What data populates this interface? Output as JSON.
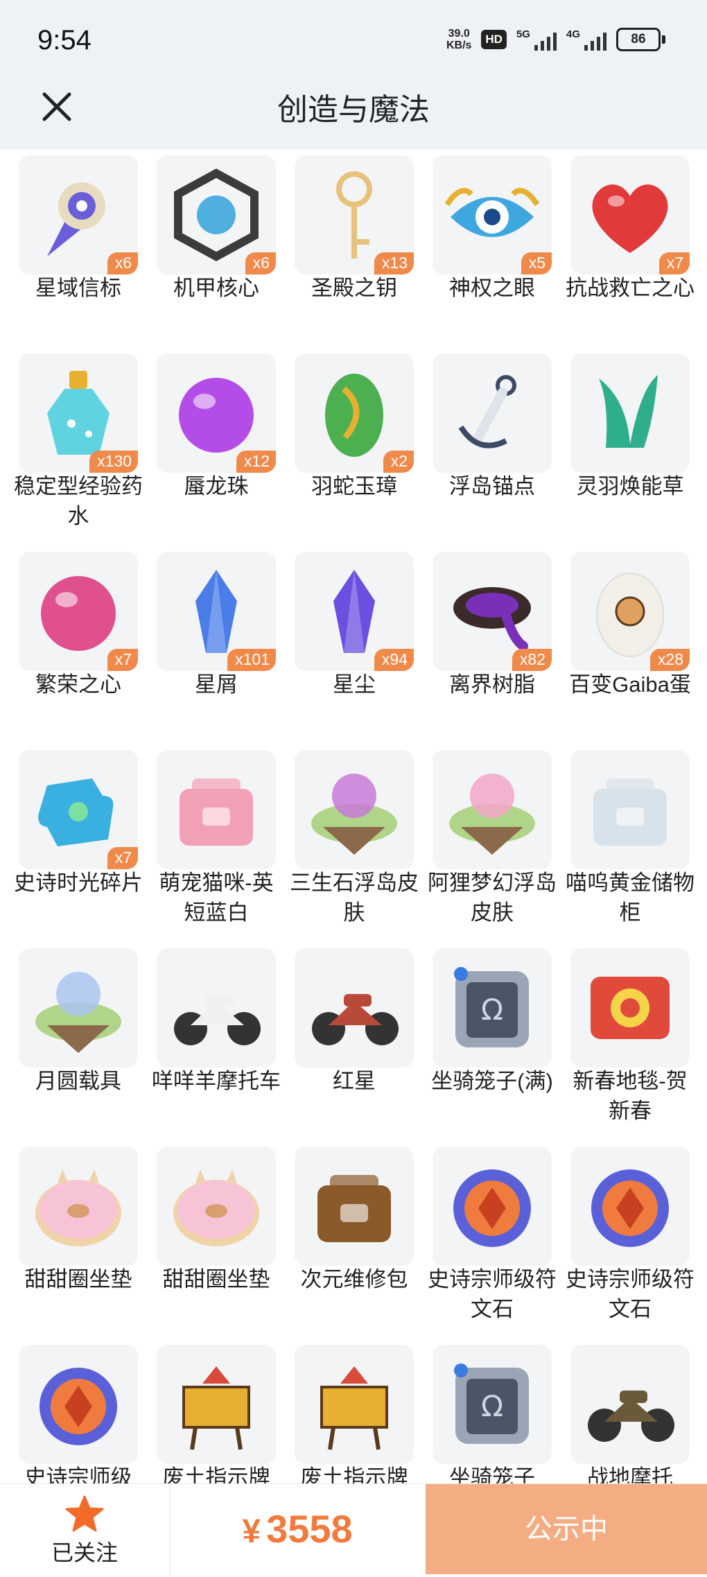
{
  "status_bar": {
    "time": "9:54",
    "net_speed_value": "39.0",
    "net_speed_unit": "KB/s",
    "hd_badge": "HD",
    "signal_1_label": "5G",
    "signal_2_label": "4G",
    "battery": "86"
  },
  "header": {
    "title": "创造与魔法",
    "close_icon": "close-icon"
  },
  "items": [
    {
      "name": "星域信标",
      "qty": "x6",
      "icon": "star-beacon-icon",
      "color": "#6a5fd8"
    },
    {
      "name": "机甲核心",
      "qty": "x6",
      "icon": "mecha-core-icon",
      "color": "#3b3b3b"
    },
    {
      "name": "圣殿之钥",
      "qty": "x13",
      "icon": "temple-key-icon",
      "color": "#e8c27a"
    },
    {
      "name": "神权之眼",
      "qty": "x5",
      "icon": "divine-eye-icon",
      "color": "#3fa7e0"
    },
    {
      "name": "抗战救亡之心",
      "qty": "x7",
      "icon": "red-heart-icon",
      "color": "#e03a3a"
    },
    {
      "name": "稳定型经验药水",
      "qty": "x130",
      "icon": "exp-potion-icon",
      "color": "#5fd3e0"
    },
    {
      "name": "蜃龙珠",
      "qty": "x12",
      "icon": "purple-orb-icon",
      "color": "#b44de8"
    },
    {
      "name": "羽蛇玉璋",
      "qty": "x2",
      "icon": "jade-tablet-icon",
      "color": "#4caf50"
    },
    {
      "name": "浮岛锚点",
      "qty": "",
      "icon": "anchor-icon",
      "color": "#3d4a63"
    },
    {
      "name": "灵羽焕能草",
      "qty": "",
      "icon": "spirit-grass-icon",
      "color": "#2fae8c"
    },
    {
      "name": "繁荣之心",
      "qty": "x7",
      "icon": "pink-gem-icon",
      "color": "#e0508f"
    },
    {
      "name": "星屑",
      "qty": "x101",
      "icon": "star-shard-icon",
      "color": "#4a7de8"
    },
    {
      "name": "星尘",
      "qty": "x94",
      "icon": "crystal-icon",
      "color": "#6a4fe0"
    },
    {
      "name": "离界树脂",
      "qty": "x82",
      "icon": "resin-icon",
      "color": "#7a2fb8"
    },
    {
      "name": "百变Gaiba蛋",
      "qty": "x28",
      "icon": "egg-icon",
      "color": "#f2efe8"
    },
    {
      "name": "史诗时光碎片",
      "qty": "x7",
      "icon": "puzzle-piece-icon",
      "color": "#3ab0e0"
    },
    {
      "name": "萌宠猫咪-英短蓝白",
      "qty": "",
      "icon": "cat-house-icon",
      "color": "#f2a0b5"
    },
    {
      "name": "三生石浮岛皮肤",
      "qty": "",
      "icon": "floating-island-icon",
      "color": "#c77ad8"
    },
    {
      "name": "阿狸梦幻浮岛皮肤",
      "qty": "",
      "icon": "dream-island-icon",
      "color": "#f2a6c8"
    },
    {
      "name": "喵呜黄金储物柜",
      "qty": "",
      "icon": "cat-cabinet-icon",
      "color": "#d8e2ea"
    },
    {
      "name": "月圆载具",
      "qty": "",
      "icon": "cloud-moon-icon",
      "color": "#aac4f0"
    },
    {
      "name": "咩咩羊摩托车",
      "qty": "",
      "icon": "sheep-scooter-icon",
      "color": "#f0f0f0"
    },
    {
      "name": "红星",
      "qty": "",
      "icon": "motorcycle-icon",
      "color": "#b84a3a"
    },
    {
      "name": "坐骑笼子(满)",
      "qty": "",
      "icon": "mount-cage-icon",
      "color": "#4a5568"
    },
    {
      "name": "新春地毯-贺新春",
      "qty": "",
      "icon": "spring-rug-icon",
      "color": "#e04a3a"
    },
    {
      "name": "甜甜圈坐垫",
      "qty": "",
      "icon": "donut-cushion-icon",
      "color": "#f7c3d6"
    },
    {
      "name": "甜甜圈坐垫",
      "qty": "",
      "icon": "donut-cushion-icon",
      "color": "#f7c3d6"
    },
    {
      "name": "次元维修包",
      "qty": "",
      "icon": "repair-bag-icon",
      "color": "#8b5a2b"
    },
    {
      "name": "史诗宗师级符文石",
      "qty": "",
      "icon": "rune-stone-icon",
      "color": "#5a60d8"
    },
    {
      "name": "史诗宗师级符文石",
      "qty": "",
      "icon": "rune-stone-icon",
      "color": "#5a60d8"
    },
    {
      "name": "史诗宗师级",
      "qty": "",
      "icon": "rune-stone-icon",
      "color": "#5a60d8"
    },
    {
      "name": "废土指示牌",
      "qty": "",
      "icon": "wasteland-sign-icon",
      "color": "#e8b030"
    },
    {
      "name": "废土指示牌",
      "qty": "",
      "icon": "wasteland-sign-icon",
      "color": "#e8b030"
    },
    {
      "name": "坐骑笼子",
      "qty": "",
      "icon": "mount-cage-icon",
      "color": "#4a5568"
    },
    {
      "name": "战地摩托",
      "qty": "",
      "icon": "war-motorcycle-icon",
      "color": "#6b5a3a"
    }
  ],
  "bottom_bar": {
    "follow_label": "已关注",
    "follow_icon": "star-icon",
    "price_symbol": "¥",
    "price_value": "3558",
    "status_button": "公示中",
    "accent": "#f07b3f"
  }
}
